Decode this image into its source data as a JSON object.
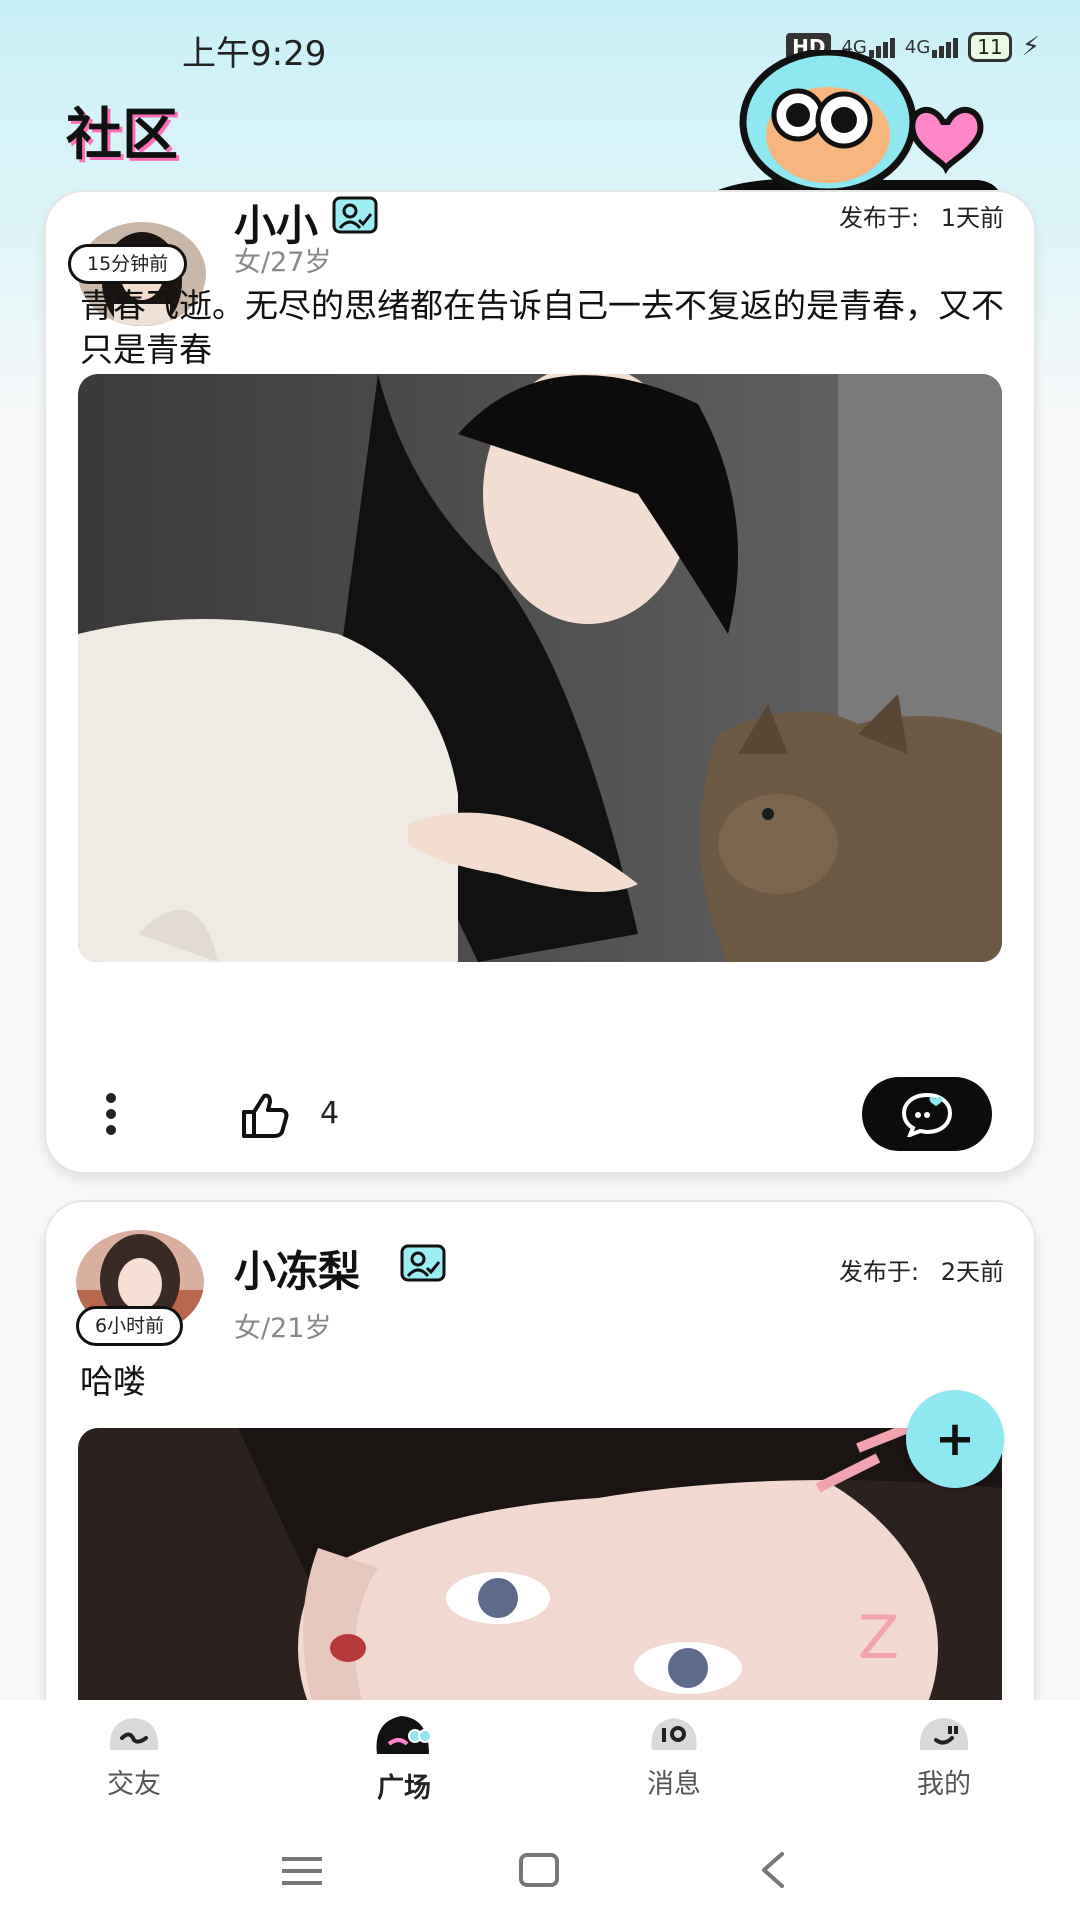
{
  "status_bar": {
    "time": "上午9:29",
    "hd_label": "HD",
    "network_1": "4G",
    "network_2": "4G",
    "battery": "11"
  },
  "header": {
    "title": "社区"
  },
  "posts": [
    {
      "username": "小小",
      "time_ago": "15分钟前",
      "meta": "女/27岁",
      "published_label": "发布于:",
      "published_value": "1天前",
      "text": "青春飞逝。无尽的思绪都在告诉自己一去不复返的是青春，又不只是青春",
      "likes": "4"
    },
    {
      "username": "小冻梨",
      "time_ago": "6小时前",
      "meta": "女/21岁",
      "published_label": "发布于:",
      "published_value": "2天前",
      "text": "哈喽"
    }
  ],
  "fab": {
    "label": "+"
  },
  "bottom_nav": {
    "items": [
      {
        "label": "交友",
        "icon": "friends-icon"
      },
      {
        "label": "广场",
        "icon": "square-icon",
        "active": true
      },
      {
        "label": "消息",
        "icon": "message-icon"
      },
      {
        "label": "我的",
        "icon": "profile-icon"
      }
    ]
  },
  "colors": {
    "accent_cyan": "#8fe7ef",
    "title_pink": "#ff6fb5"
  }
}
